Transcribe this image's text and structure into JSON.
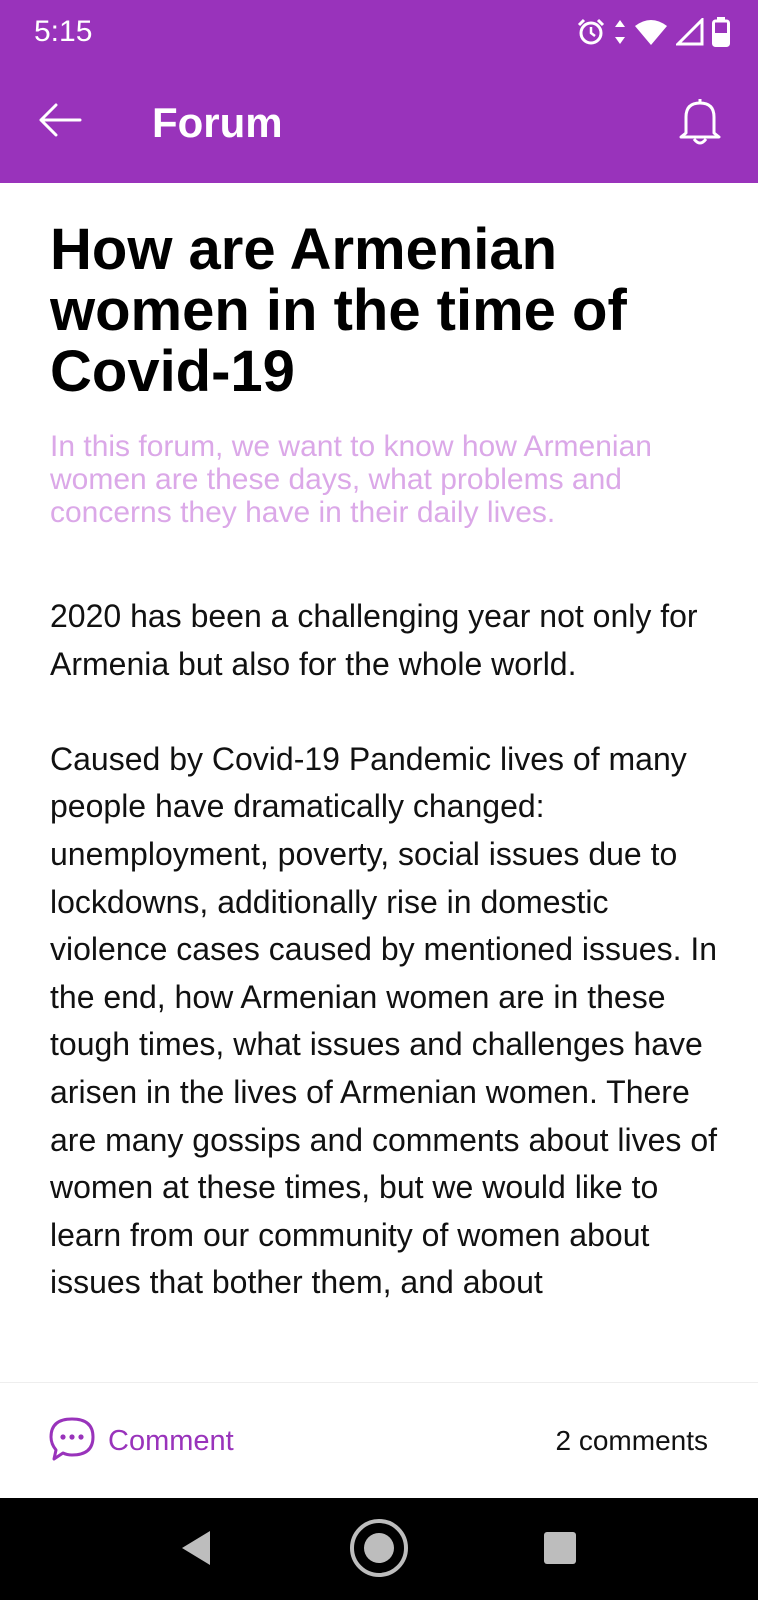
{
  "status_bar": {
    "time": "5:15",
    "icons": [
      "alarm-icon",
      "data-arrows-icon",
      "wifi-icon",
      "signal-icon",
      "battery-icon"
    ]
  },
  "app_bar": {
    "title": "Forum",
    "back_icon": "arrow-left-icon",
    "action_icon": "bell-icon",
    "background": "#9933bb"
  },
  "post": {
    "title": "How are Armenian women in the time of Covid-19",
    "subtitle": "In this forum, we want to know how Armenian women are these days, what problems and concerns they have in their daily lives.",
    "paragraphs": [
      "2020 has been a challenging year not only for Armenia but also for the whole world.",
      "Caused by Covid-19 Pandemic lives of many people have dramatically changed: unemployment, poverty, social issues due to lockdowns, additionally rise in domestic violence cases caused by mentioned issues. In the end, how Armenian women are in these tough times, what issues and challenges have arisen in the lives of Armenian women. There are many gossips and comments about lives of women at these times, but we would like to learn from our community of women about issues that bother them, and about"
    ]
  },
  "bottom_bar": {
    "comment_label": "Comment",
    "comment_icon": "chat-bubble-icon",
    "comment_count": "2 comments"
  },
  "nav_bar": {
    "icons": [
      "nav-back-icon",
      "nav-home-icon",
      "nav-recents-icon"
    ]
  },
  "colors": {
    "accent": "#9933bb",
    "subtitle": "#dba8e8",
    "text": "#111111"
  }
}
